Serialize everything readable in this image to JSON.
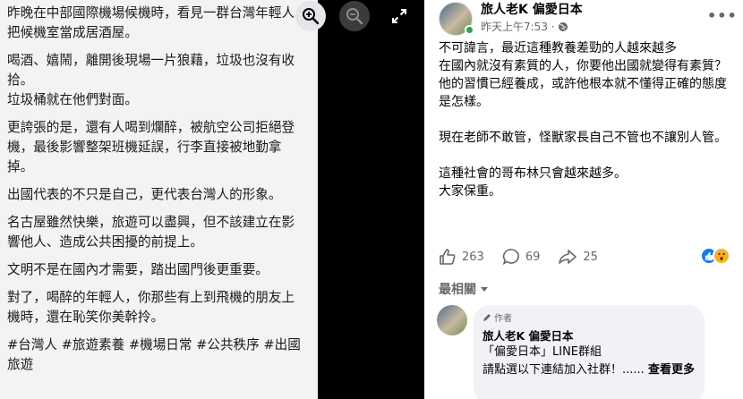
{
  "photo": {
    "paragraphs": [
      "昨晚在中部國際機場候機時，看見一群台灣年輕人把候機室當成居酒屋。",
      "喝酒、嬉鬧，離開後現場一片狼藉，垃圾也沒有收拾。",
      "垃圾桶就在他們對面。",
      "更誇張的是，還有人喝到爛醉，被航空公司拒絕登機，最後影響整架班機延誤，行李直接被地勤拿掉。",
      "出國代表的不只是自己，更代表台灣人的形象。",
      "名古屋雖然快樂，旅遊可以盡興，但不該建立在影響他人、造成公共困擾的前提上。",
      "文明不是在國內才需要，踏出國門後更重要。",
      "對了，喝醉的年輕人，你那些有上到飛機的朋友上機時，還在恥笑你美幹拎。",
      "#台灣人 #旅遊素養 #機場日常 #公共秩序 #出國旅遊"
    ]
  },
  "viewer": {
    "icons": [
      "zoom-in-icon",
      "zoom-out-icon",
      "expand-icon"
    ]
  },
  "post": {
    "page_name": "旅人老K 偏愛日本",
    "time": "昨天上午7:53 ·",
    "body": [
      "不可諱言，最近這種教養差勁的人越來越多\n在國內就沒有素質的人，你要他出國就變得有素質？他的習慣已經養成，或許他根本就不懂得正確的態度是怎樣。",
      "現在老師不敢管，怪獸家長自己不管也不讓別人管。",
      "這種社會的哥布林只會越來越多。\n大家保重。"
    ],
    "likes": "263",
    "comments": "69",
    "shares": "25",
    "sort_label": "最相關"
  },
  "comment": {
    "badge": "作者",
    "author": "旅人老K 偏愛日本",
    "line1": "「偏愛日本」LINE群組",
    "line2": "請點選以下連結加入社群！......",
    "see_more": "查看更多"
  },
  "colors": {
    "accent": "#1877f2",
    "secondary_text": "#65676b",
    "online": "#31a24c"
  }
}
